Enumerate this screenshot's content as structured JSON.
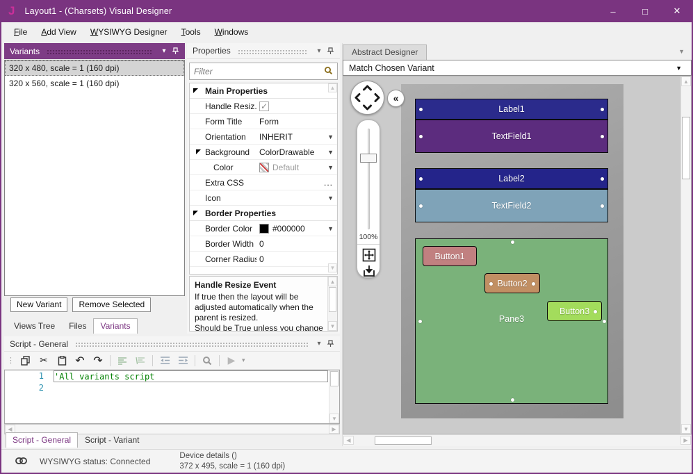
{
  "window": {
    "logo_letter": "J",
    "title": "Layout1 - (Charsets) Visual Designer",
    "minimize": "–",
    "maximize": "□",
    "close": "✕"
  },
  "colors": {
    "titlebar": "#7a3480",
    "panel_header_purple": "#7d3c85",
    "logo_pink": "#cc2f9a",
    "selected_item_gray": "#d4d4d4",
    "canvas_gray": "#cbcbcb",
    "device_form_gray": "#9e9e9e",
    "comment_green": "#008000",
    "line_number_blue": "#2b91af"
  },
  "menubar": {
    "items": [
      {
        "mnemonic": "F",
        "rest": "ile",
        "label": "File"
      },
      {
        "mnemonic": "A",
        "rest": "dd View",
        "label": "Add View"
      },
      {
        "mnemonic": "W",
        "rest": "YSIWYG Designer",
        "label": "WYSIWYG Designer"
      },
      {
        "mnemonic": "T",
        "rest": "ools",
        "label": "Tools"
      },
      {
        "mnemonic": "W",
        "rest": "indows",
        "label": "Windows"
      }
    ]
  },
  "variants_panel": {
    "title": "Variants",
    "items": [
      {
        "label": "320 x 480, scale = 1 (160 dpi)",
        "selected": true
      },
      {
        "label": "320 x 560, scale = 1 (160 dpi)",
        "selected": false
      }
    ],
    "new_button": "New Variant",
    "remove_button": "Remove Selected",
    "tabs": [
      {
        "label": "Views Tree",
        "active": false
      },
      {
        "label": "Files",
        "active": false
      },
      {
        "label": "Variants",
        "active": true
      }
    ]
  },
  "properties_panel": {
    "title": "Properties",
    "filter_placeholder": "Filter",
    "rows": [
      {
        "type": "group",
        "label": "Main Properties"
      },
      {
        "type": "checkbox",
        "label": "Handle Resiz...",
        "checked": "✓"
      },
      {
        "type": "text",
        "label": "Form Title",
        "value": "Form"
      },
      {
        "type": "dropdown",
        "label": "Orientation",
        "value": "INHERIT"
      },
      {
        "type": "dropdown",
        "label": "Background",
        "value": "ColorDrawable"
      },
      {
        "type": "dropdown",
        "label": "Color",
        "value": "Default"
      },
      {
        "type": "ellipsis",
        "label": "Extra CSS",
        "value": "..."
      },
      {
        "type": "dropdown",
        "label": "Icon",
        "value": ""
      },
      {
        "type": "group",
        "label": "Border Properties"
      },
      {
        "type": "dropdown",
        "label": "Border Color",
        "value": "#000000"
      },
      {
        "type": "text",
        "label": "Border Width",
        "value": "0"
      },
      {
        "type": "text",
        "label": "Corner Radius",
        "value": "0"
      }
    ],
    "description": {
      "title": "Handle Resize Event",
      "body": "If true then the layout will be adjusted automatically when the parent is resized.",
      "body_more": "Should be True unless you change"
    }
  },
  "script_panel": {
    "title": "Script - General",
    "lines": [
      {
        "number": "1",
        "code": "'All variants script"
      },
      {
        "number": "2",
        "code": ""
      }
    ],
    "tabs": [
      {
        "label": "Script - General",
        "active": true
      },
      {
        "label": "Script - Variant",
        "active": false
      }
    ]
  },
  "designer": {
    "tab": "Abstract Designer",
    "variant_combo": "Match Chosen Variant",
    "zoom_label": "100%",
    "collapse_glyph": "«",
    "widgets": {
      "label1": {
        "text": "Label1",
        "color": "#2b2b8c"
      },
      "textfield1": {
        "text": "TextField1",
        "color": "#5c2c7e"
      },
      "label2": {
        "text": "Label2",
        "color": "#24248a"
      },
      "textfield2": {
        "text": "TextField2",
        "color": "#7fa3b8"
      },
      "pane3": {
        "text": "Pane3",
        "color": "#7ab27a"
      },
      "button1": {
        "text": "Button1",
        "color": "#c18080"
      },
      "button2": {
        "text": "Button2",
        "color": "#c18f63"
      },
      "button3": {
        "text": "Button3",
        "color": "#a3dc5c"
      }
    }
  },
  "statusbar": {
    "wysiwyg_status": "WYSIWYG status: Connected",
    "device_details_line1": "Device details ()",
    "device_details_line2": "372 x 495, scale = 1 (160 dpi)"
  }
}
